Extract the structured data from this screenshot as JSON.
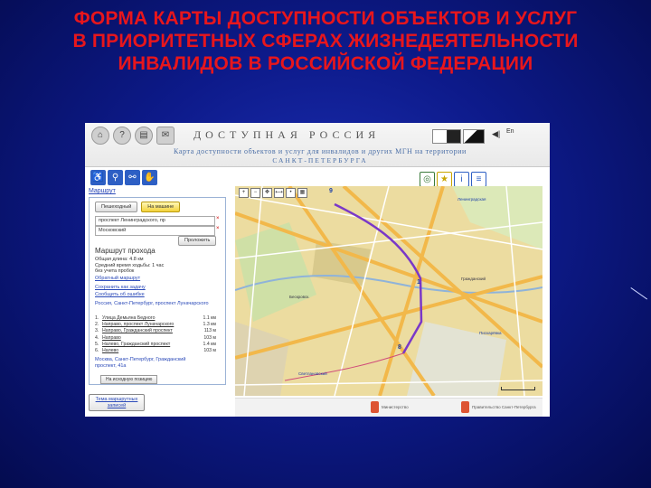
{
  "slide": {
    "title_lines": [
      "ФОРМА КАРТЫ ДОСТУПНОСТИ ОБЪЕКТОВ И УСЛУГ",
      "В ПРИОРИТЕТНЫХ СФЕРАХ ЖИЗНЕДЕЯТЕЛЬНОСТИ",
      "ИНВАЛИДОВ В РОССИЙСКОЙ ФЕДЕРАЦИИ"
    ],
    "title_color": "#e8161c",
    "background_color": "#0d1a8a"
  },
  "site": {
    "title": "ДОСТУПНАЯ РОССИЯ",
    "subtitle_line1": "Карта доступности объектов и услуг для инвалидов и других МГН на территории",
    "subtitle_line2": "САНКТ-ПЕТЕРБУРГА",
    "language": "En",
    "header_icons": [
      "home-icon",
      "help-icon",
      "print-icon",
      "mail-icon"
    ],
    "accessibility_icons": [
      "wheelchair-icon",
      "walking-person-icon",
      "blind-person-icon",
      "deaf-person-icon"
    ],
    "filter_icons": [
      "globe-icon",
      "star-icon",
      "info-icon",
      "list-icon"
    ]
  },
  "route_panel": {
    "link": "Маршрут",
    "mode_walk": "Пешеходный",
    "mode_car": "На машине",
    "address_from": "проспект Ленинградского, пр",
    "address_to": "Московский",
    "find_button": "Проложить",
    "section_title": "Маршрут прохода",
    "summary_lines": [
      "Общая длина: 4.8 км",
      "Средний время ходьбы: 1 час",
      "без учета пробок"
    ],
    "link_reverse": "Обратный маршрут",
    "link_save": "Сохранить как задачу",
    "link_report": "Сообщить об ошибке",
    "start_address": "Россия, Санкт-Петербург, проспект Луначарского",
    "steps": [
      {
        "n": "1.",
        "text": "Улица Демьяна Бедного",
        "dist": "1.1 км"
      },
      {
        "n": "2.",
        "text": "Направо, проспект Луначарского",
        "dist": "1.3 км"
      },
      {
        "n": "3.",
        "text": "Направо, Гражданский проспект",
        "dist": "113 м"
      },
      {
        "n": "4.",
        "text": "Направо",
        "dist": "103 м"
      },
      {
        "n": "5.",
        "text": "Налево, Гражданский проспект",
        "dist": "1.4 км"
      },
      {
        "n": "6.",
        "text": "Налево",
        "dist": "103 м"
      }
    ],
    "end_address_lines": [
      "Москва, Санкт-Петербург, Гражданский",
      "проспект, 41а"
    ],
    "end_button": "На исходную позицию",
    "bottom_button_line1": "Тема маршрутных",
    "bottom_button_line2": "записей"
  },
  "map": {
    "labels": [
      "Ленинградская",
      "Гражданский",
      "Светлановский",
      "Пискарёвка",
      "Бескровск."
    ],
    "markers": [
      "9",
      "1",
      "8"
    ],
    "route_color": "#7a38c8"
  },
  "footer": {
    "logo1": "Министерство",
    "logo2": "Правительство Санкт-Петербурга"
  }
}
